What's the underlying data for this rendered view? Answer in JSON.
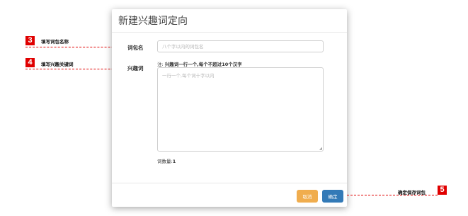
{
  "modal": {
    "title": "新建兴趣词定向",
    "group_name": {
      "label": "词包名",
      "placeholder": "八个字以内的词包名",
      "value": ""
    },
    "keywords": {
      "label": "兴趣词",
      "hint_prefix": "注:",
      "hint_text": "兴趣词一行一个,每个不超过10个汉字",
      "placeholder": "一行一个,每个词十字以内",
      "value": ""
    },
    "count": {
      "label": "词数量:",
      "value": "1"
    },
    "buttons": {
      "cancel": "取消",
      "confirm": "确定"
    }
  },
  "annotations": [
    {
      "number": "3",
      "text": "填写词包名称"
    },
    {
      "number": "4",
      "text": "填写兴趣关键词"
    },
    {
      "number": "5",
      "text": "确定保存词包"
    }
  ],
  "colors": {
    "annotation_red": "#e00000",
    "cancel_button": "#f0ad4e",
    "confirm_button": "#337ab7"
  }
}
